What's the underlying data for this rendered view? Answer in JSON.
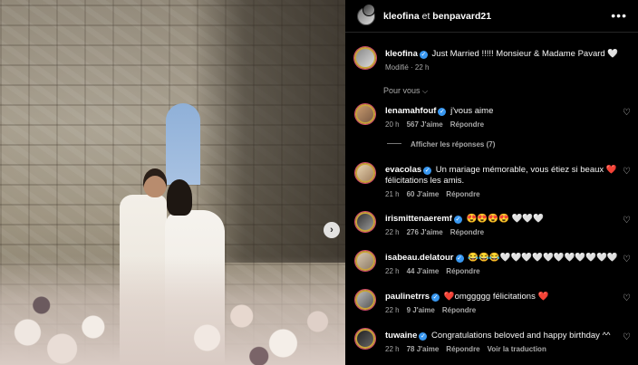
{
  "post": {
    "owner_a": "kleofina",
    "joiner": "et",
    "owner_b": "benpavard21",
    "more_label": "•••"
  },
  "caption": {
    "username": "kleofina",
    "text": "Just Married !!!!! Monsieur & Madame Pavard 🤍",
    "meta": "Modifié · 22 h"
  },
  "sort_label": "Pour vous",
  "comments": [
    {
      "username": "lenamahfouf",
      "verified": true,
      "text": "j'vous aime",
      "time": "20 h",
      "likes": "567 J'aime",
      "reply": "Répondre"
    },
    {
      "username": "evacolas",
      "verified": true,
      "text": "Un mariage mémorable, vous étiez si beaux ❤️",
      "text2": "félicitations les amis.",
      "time": "21 h",
      "likes": "60 J'aime",
      "reply": "Répondre"
    },
    {
      "username": "irismittenaeremf",
      "verified": true,
      "text": "😍😍😍😍 🤍🤍🤍",
      "time": "22 h",
      "likes": "276 J'aime",
      "reply": "Répondre"
    },
    {
      "username": "isabeau.delatour",
      "verified": true,
      "text": "😂😂😂🤍🤍🤍🤍🤍🤍🤍🤍🤍🤍🤍",
      "time": "22 h",
      "likes": "44 J'aime",
      "reply": "Répondre"
    },
    {
      "username": "paulinetrrs",
      "verified": true,
      "text": "❤️omggggg félicitations ❤️",
      "time": "22 h",
      "likes": "9 J'aime",
      "reply": "Répondre"
    },
    {
      "username": "tuwaine",
      "verified": true,
      "text": "Congratulations beloved and happy birthday ^^",
      "time": "22 h",
      "likes": "78 J'aime",
      "reply": "Répondre",
      "translate": "Voir la traduction"
    }
  ],
  "view_replies": "Afficher les réponses (7)",
  "icons": {
    "heart": "heart-icon",
    "verified": "verified-badge-icon",
    "next": "chevron-right-icon",
    "chevron": "chevron-down-icon"
  },
  "colors": {
    "background": "#000000",
    "verified": "#3897f0",
    "muted": "#a8a8a8"
  }
}
